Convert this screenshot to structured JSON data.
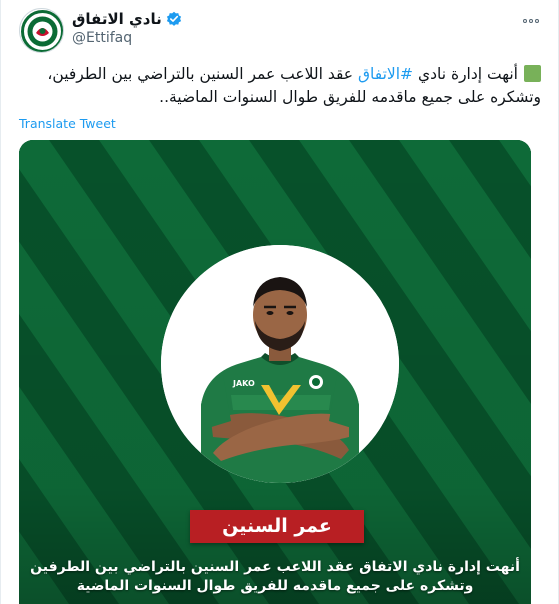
{
  "account": {
    "display_name": "نادي الاتفاق",
    "handle": "@Ettifaq",
    "avatar_icon": "ettifaq-club-logo-icon",
    "verified_icon": "verified-badge-icon"
  },
  "menu": {
    "more_icon": "more-options-icon"
  },
  "tweet": {
    "emoji_icon": "green-square-icon",
    "text_before": "أنهت إدارة نادي ",
    "hashtag": "#الاتفاق",
    "text_after": " عقد اللاعب عمر السنين بالتراضي بين الطرفين، وتشكره على جميع ماقدمه للفريق طوال السنوات الماضية..",
    "translate_label": "Translate Tweet"
  },
  "media": {
    "player_name": "عمر السنين",
    "caption_line1": "أنهت إدارة نادي الاتفاق عقد اللاعب عمر السنين بالتراضي بين الطرفين",
    "caption_line2": "وتشكره على جميع ماقدمه للفريق طوال السنوات الماضية",
    "shirt_text": "JAKO",
    "colors": {
      "background": "#07512a",
      "stripe": "#0e6a38",
      "banner": "#b81f23",
      "jersey": "#1f7a45"
    }
  }
}
